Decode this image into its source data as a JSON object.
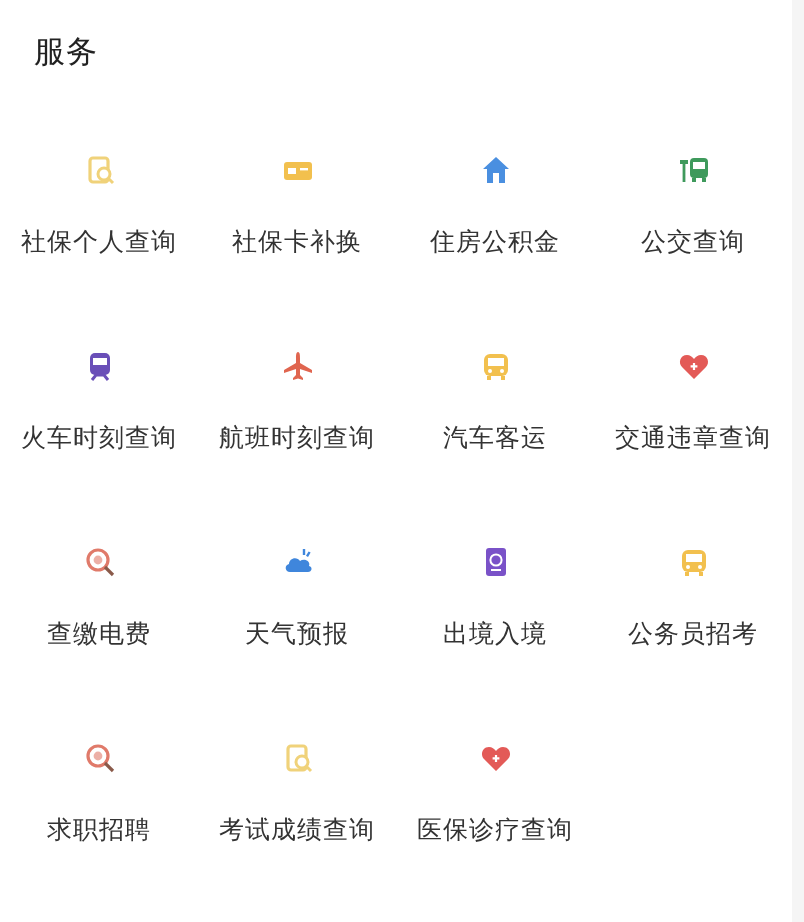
{
  "section": {
    "title": "服务"
  },
  "services": [
    {
      "label": "社保个人查询",
      "kind": "document",
      "color": "#f0d27a"
    },
    {
      "label": "社保卡补换",
      "kind": "card",
      "color": "#f2c04e"
    },
    {
      "label": "住房公积金",
      "kind": "house",
      "color": "#4a8fe0"
    },
    {
      "label": "公交查询",
      "kind": "bus-stop",
      "color": "#3f9a5c"
    },
    {
      "label": "火车时刻查询",
      "kind": "train",
      "color": "#6a4fb8"
    },
    {
      "label": "航班时刻查询",
      "kind": "plane",
      "color": "#e0654f"
    },
    {
      "label": "汽车客运",
      "kind": "bus",
      "color": "#f2c04e"
    },
    {
      "label": "交通违章查询",
      "kind": "heart",
      "color": "#e35a57"
    },
    {
      "label": "查缴电费",
      "kind": "magnifier",
      "color": "#e07a6a"
    },
    {
      "label": "天气预报",
      "kind": "cloud",
      "color": "#3f86dc"
    },
    {
      "label": "出境入境",
      "kind": "passport",
      "color": "#7a52c8"
    },
    {
      "label": "公务员招考",
      "kind": "bus",
      "color": "#f2c04e"
    },
    {
      "label": "求职招聘",
      "kind": "magnifier",
      "color": "#e07a6a"
    },
    {
      "label": "考试成绩查询",
      "kind": "document",
      "color": "#f0d27a"
    },
    {
      "label": "医保诊疗查询",
      "kind": "heart",
      "color": "#e35a57"
    }
  ]
}
